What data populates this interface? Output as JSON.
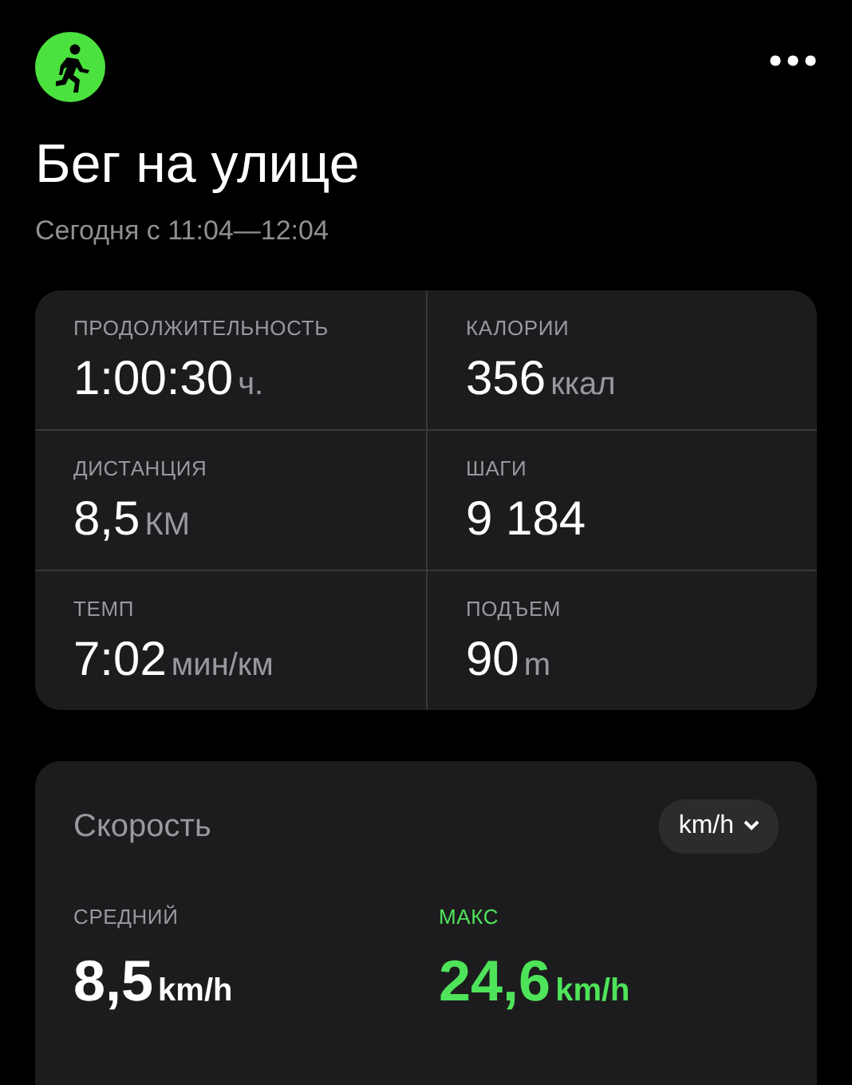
{
  "header": {
    "title": "Бег на улице",
    "subtitle": "Сегодня с 11:04—12:04"
  },
  "stats": [
    {
      "label": "ПРОДОЛЖИТЕЛЬНОСТЬ",
      "value": "1:00:30",
      "unit": "ч."
    },
    {
      "label": "КАЛОРИИ",
      "value": "356",
      "unit": "ккал"
    },
    {
      "label": "ДИСТАНЦИЯ",
      "value": "8,5",
      "unit": "КМ"
    },
    {
      "label": "ШАГИ",
      "value": "9 184"
    },
    {
      "label": "ТЕМП",
      "value": "7:02",
      "unit": "мин/км"
    },
    {
      "label": "ПОДЪЕМ",
      "value": "90",
      "unit": "m"
    }
  ],
  "speed": {
    "title": "Скорость",
    "unit_button": "km/h",
    "metrics": [
      {
        "label": "СРЕДНИЙ",
        "value": "8,5",
        "unit": "km/h",
        "highlight": false
      },
      {
        "label": "МАКС",
        "value": "24,6",
        "unit": "km/h",
        "highlight": true
      }
    ]
  }
}
